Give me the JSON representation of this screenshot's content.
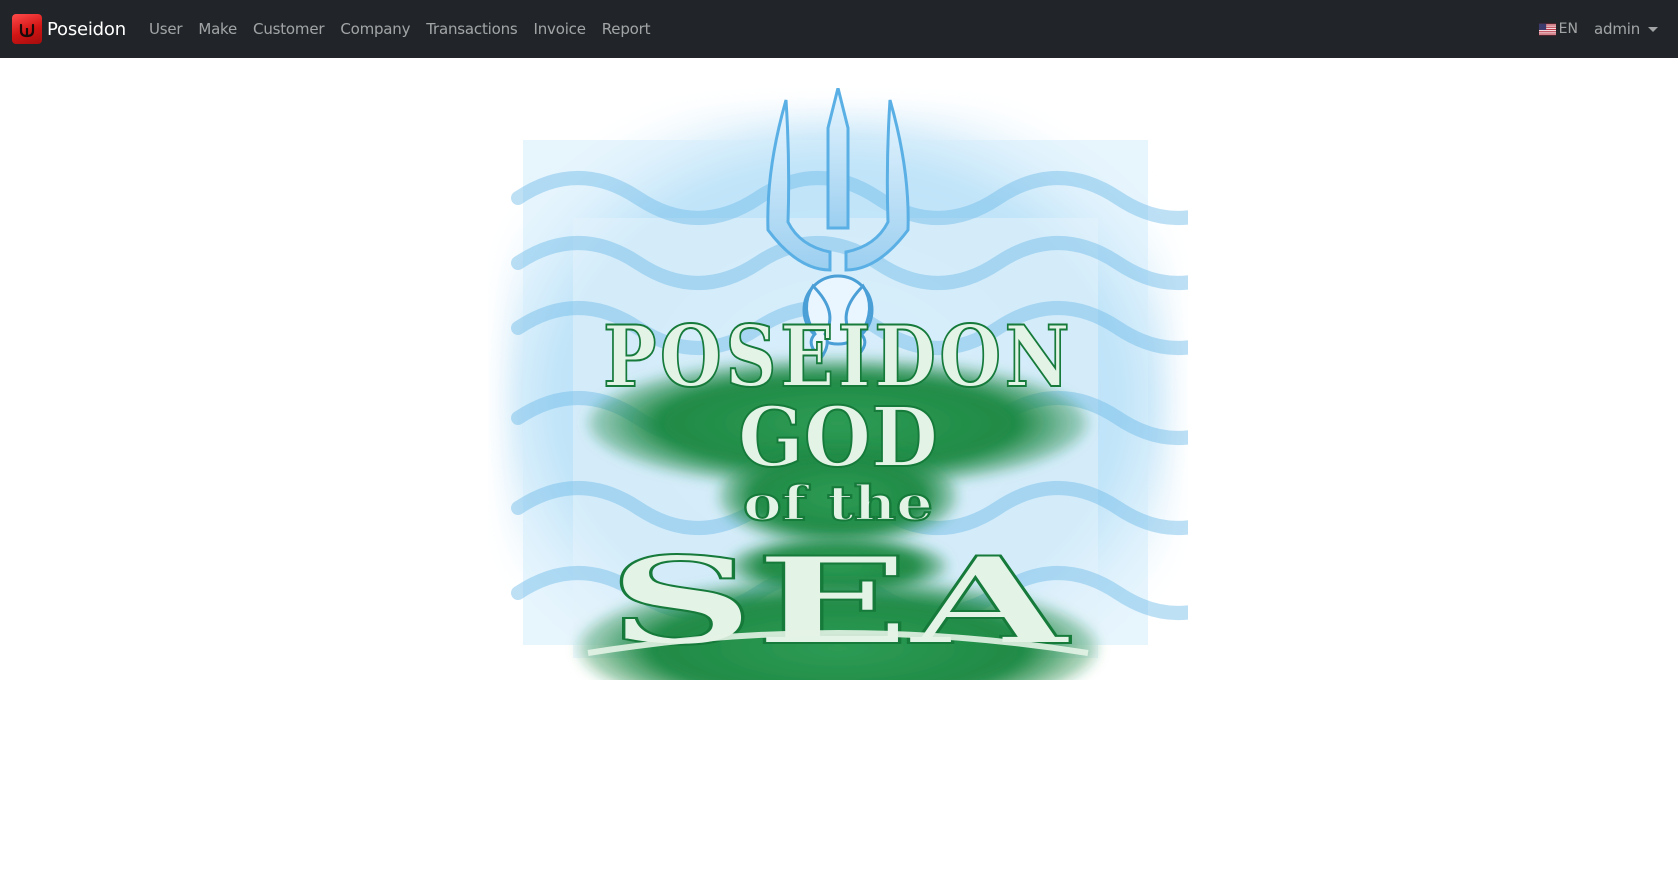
{
  "navbar": {
    "brand_name": "Poseidon",
    "brand_color": "#e02020",
    "background": "#212529",
    "menu": [
      {
        "label": "User"
      },
      {
        "label": "Make"
      },
      {
        "label": "Customer"
      },
      {
        "label": "Company"
      },
      {
        "label": "Transactions"
      },
      {
        "label": "Invoice"
      },
      {
        "label": "Report"
      }
    ],
    "language": {
      "label": "EN",
      "flag_icon": "us-flag-icon"
    },
    "user": {
      "label": "admin",
      "icon": "caret-down-icon"
    }
  },
  "hero": {
    "image_icon": "poseidon-trident-logo",
    "text": {
      "line1": "POSEIDON",
      "line2": "GOD",
      "line3": "of the",
      "line4": "SEA"
    },
    "colors": {
      "water": "#8ecdf2",
      "green": "#1f8a45",
      "letters": "#e3f3e6"
    }
  }
}
